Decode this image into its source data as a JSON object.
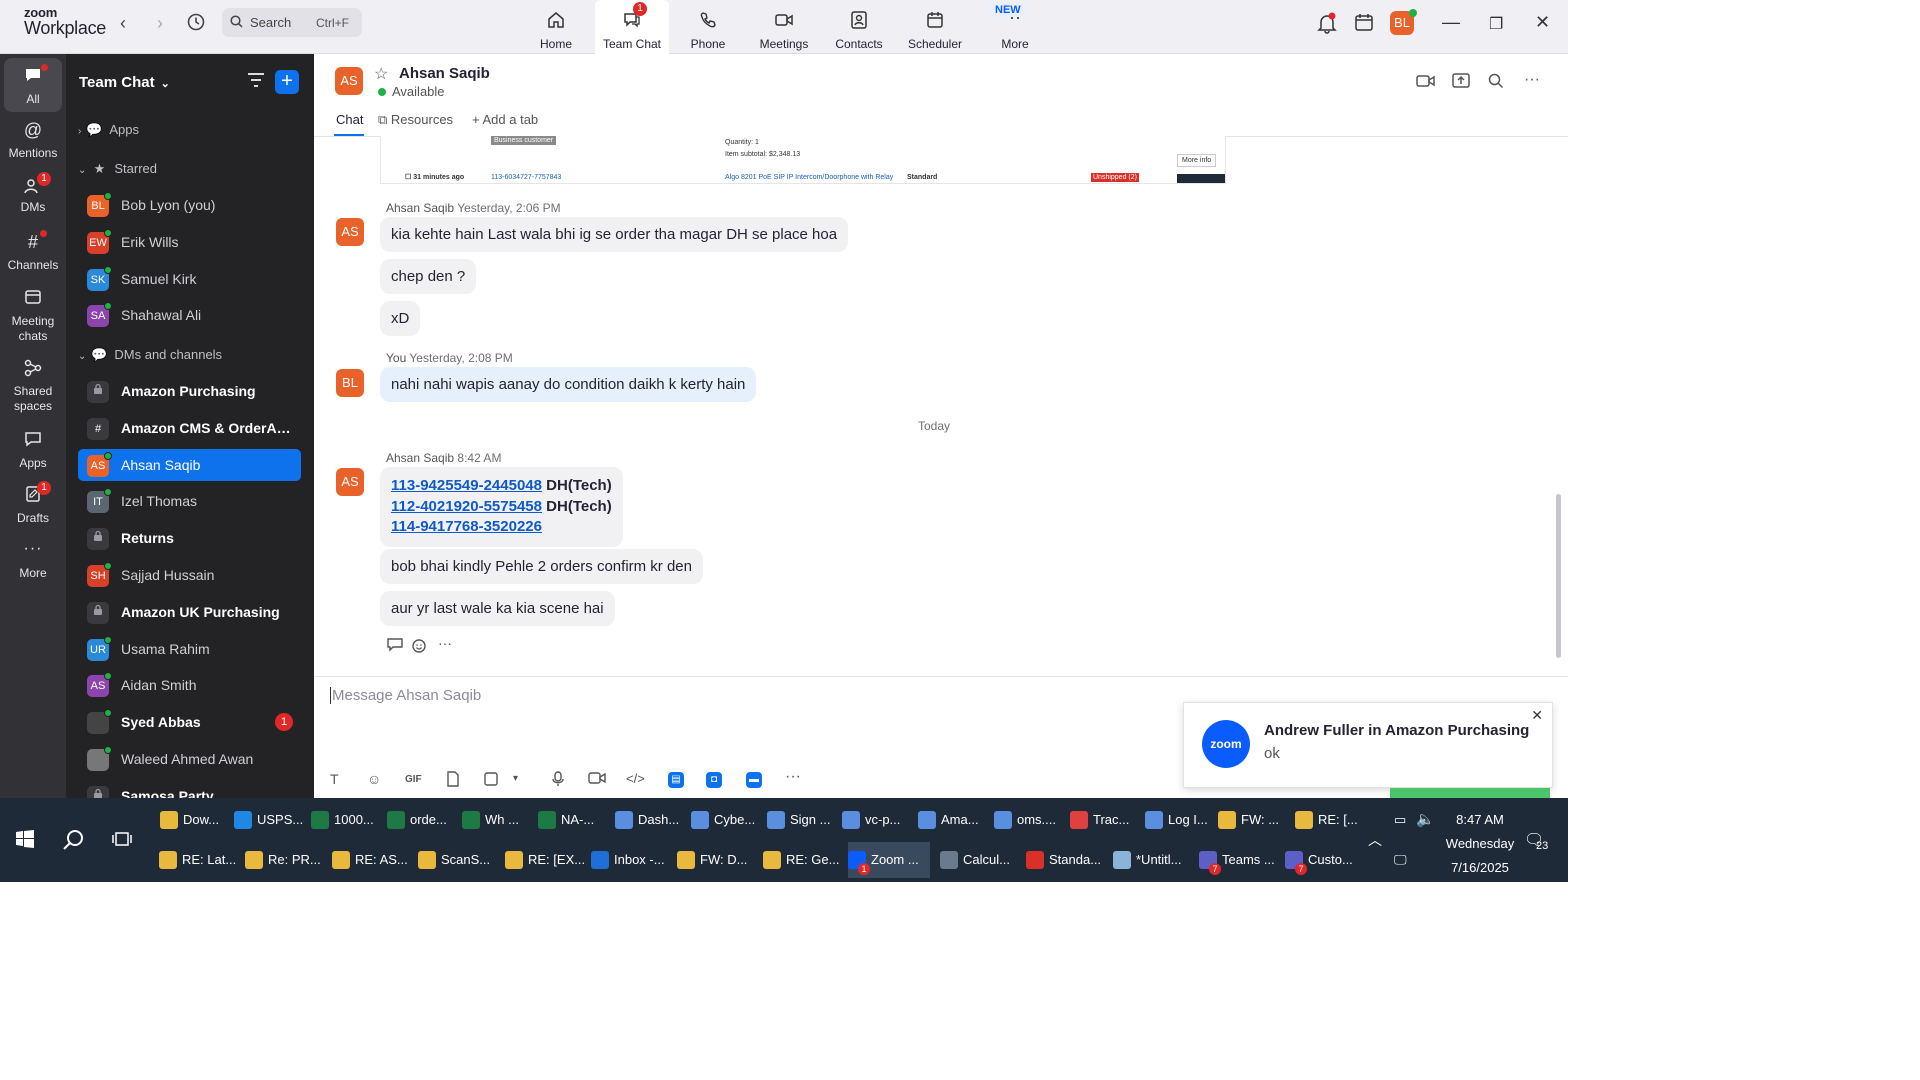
{
  "app": {
    "brand_top": "zoom",
    "brand_bottom": "Workplace"
  },
  "search": {
    "label": "Search",
    "shortcut": "Ctrl+F"
  },
  "tabs": [
    {
      "label": "Home",
      "icon": "home-icon"
    },
    {
      "label": "Team Chat",
      "icon": "chat-icon",
      "badge": "1"
    },
    {
      "label": "Phone",
      "icon": "phone-icon"
    },
    {
      "label": "Meetings",
      "icon": "video-icon"
    },
    {
      "label": "Contacts",
      "icon": "contacts-icon"
    },
    {
      "label": "Scheduler",
      "icon": "calendar-icon"
    },
    {
      "label": "More",
      "icon": "more-icon",
      "tag": "NEW"
    }
  ],
  "user": {
    "initials": "BL"
  },
  "rail": [
    {
      "label": "All"
    },
    {
      "label": "Mentions"
    },
    {
      "label": "DMs",
      "badge": "1"
    },
    {
      "label": "Channels"
    },
    {
      "label": "Meeting chats"
    },
    {
      "label": "Shared spaces"
    },
    {
      "label": "Apps"
    },
    {
      "label": "Drafts",
      "badge": "1"
    },
    {
      "label": "More"
    }
  ],
  "sidebar": {
    "title": "Team Chat",
    "sections": {
      "apps": "Apps",
      "starred": "Starred",
      "dms": "DMs and channels"
    },
    "starred": [
      {
        "initials": "BL",
        "name": "Bob Lyon (you)",
        "color": "#e8622a"
      },
      {
        "initials": "EW",
        "name": "Erik Wills",
        "color": "#d9402a"
      },
      {
        "initials": "SK",
        "name": "Samuel Kirk",
        "color": "#2a8ad9"
      },
      {
        "initials": "SA",
        "name": "Shahawal Ali",
        "color": "#8e44ad"
      }
    ],
    "channels": [
      {
        "initials": "",
        "name": "Amazon Purchasing",
        "type": "lock"
      },
      {
        "initials": "#",
        "name": "Amazon CMS & OrderAut...",
        "type": "hash"
      },
      {
        "initials": "AS",
        "name": "Ahsan Saqib",
        "color": "#e8622a"
      },
      {
        "initials": "IT",
        "name": "Izel Thomas",
        "color": "#5b6770"
      },
      {
        "initials": "",
        "name": "Returns",
        "type": "lock"
      },
      {
        "initials": "SH",
        "name": "Sajjad Hussain",
        "color": "#d9402a"
      },
      {
        "initials": "",
        "name": "Amazon UK Purchasing",
        "type": "lock"
      },
      {
        "initials": "UR",
        "name": "Usama Rahim",
        "color": "#2a8ad9"
      },
      {
        "initials": "AS",
        "name": "Aidan Smith",
        "color": "#8e44ad"
      },
      {
        "initials": "",
        "name": "Syed Abbas",
        "color": "#444",
        "badge": "1"
      },
      {
        "initials": "",
        "name": "Waleed Ahmed Awan",
        "color": "#777"
      },
      {
        "initials": "",
        "name": "Samosa Party",
        "type": "lock"
      }
    ]
  },
  "chat": {
    "name": "Ahsan Saqib",
    "initials": "AS",
    "status": "Available",
    "tabs": [
      "Chat",
      "Resources",
      "Add a tab"
    ],
    "screenshot": {
      "badge": "Business customer",
      "time": "31 minutes ago",
      "order": "113-6034727-7757843",
      "quantity": "Quantity: 1",
      "subtotal": "Item subtotal: $2,348.13",
      "product": "Algo 8201 PoE SIP IP Intercom/Doorphone with Relay",
      "shipping": "Standard",
      "status": "Unshipped (2)",
      "more": "More info"
    },
    "groups": [
      {
        "sender": "Ahsan Saqib",
        "time": "Yesterday, 2:06 PM",
        "messages": [
          "kia kehte hain Last wala bhi ig se order tha magar DH se place hoa",
          "chep den ?",
          "xD"
        ]
      },
      {
        "sender": "You",
        "time": "Yesterday, 2:08 PM",
        "messages": [
          "nahi nahi wapis aanay do condition daikh k kerty hain"
        ]
      },
      {
        "sender": "Ahsan Saqib",
        "time": "8:42 AM",
        "links": [
          {
            "order": "113-9425549-2445048",
            "tag": "DH(Tech)"
          },
          {
            "order": "112-4021920-5575458",
            "tag": "DH(Tech)"
          },
          {
            "order": "114-9417768-3520226",
            "tag": ""
          }
        ],
        "messages": [
          "bob bhai kindly Pehle 2 orders confirm kr den",
          "aur yr last wale ka kia scene hai"
        ]
      }
    ],
    "divider": "Today",
    "composer_placeholder": "Message Ahsan Saqib",
    "toolbar": {
      "gif": "GIF"
    }
  },
  "toast": {
    "logo": "zoom",
    "title": "Andrew Fuller in Amazon Purchasing",
    "body": "ok"
  },
  "taskbar": {
    "row1": [
      "Dow...",
      "USPS...",
      "1000...",
      "orde...",
      "Wh ...",
      "NA-...",
      "Dash...",
      "Cybe...",
      "Sign ...",
      "vc-p...",
      "Ama...",
      "oms....",
      "Trac...",
      "Log I...",
      "FW: ...",
      "RE: [..."
    ],
    "row2": [
      "RE: Lat...",
      "Re: PR...",
      "RE: AS...",
      "ScanS...",
      "RE: [EX...",
      "Inbox -...",
      "FW: D...",
      "RE: Ge...",
      "Zoom ...",
      "Calcul...",
      "Standa...",
      "*Untitl...",
      "Teams ...",
      "Custo..."
    ],
    "time": "8:47 AM",
    "day": "Wednesday",
    "date": "7/16/2025",
    "notif_count": "23"
  }
}
